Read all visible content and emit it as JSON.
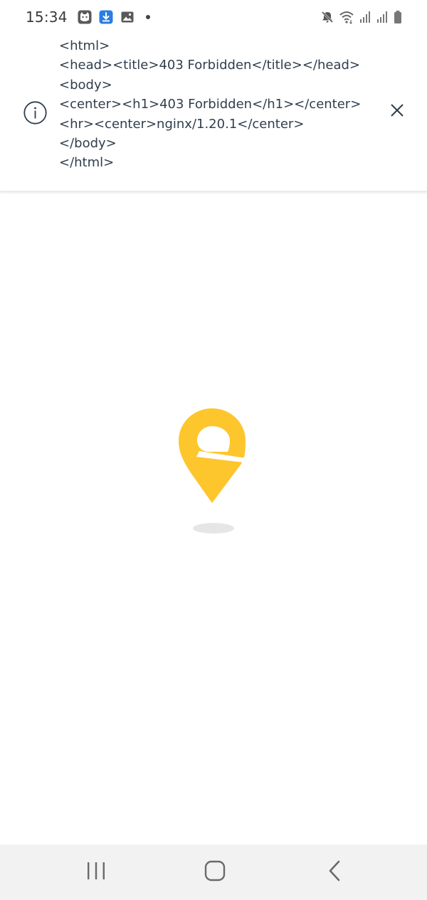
{
  "status_bar": {
    "time": "15:34",
    "notification_icons": [
      "cat-app-icon",
      "download-app-icon",
      "gallery-icon"
    ],
    "system_icons": [
      "mute-icon",
      "wifi-icon",
      "signal-icon",
      "signal-icon",
      "battery-icon"
    ]
  },
  "banner": {
    "icon": "info-icon",
    "lines": [
      "<html>",
      "<head><title>403 Forbidden</title></head>",
      "<body>",
      "<center><h1>403 Forbidden</h1></center>",
      "<hr><center>nginx/1.20.1</center>",
      "</body>",
      "</html>"
    ],
    "close_icon": "close-icon"
  },
  "loader": {
    "icon": "map-pin-icon",
    "color": "#FDC62C"
  },
  "nav_bar": {
    "buttons": [
      "recents-icon",
      "home-icon",
      "back-icon"
    ]
  },
  "colors": {
    "banner_text": "#2F3E4E",
    "brand_yellow": "#FDC62C",
    "nav_background": "#F2F2F2"
  }
}
